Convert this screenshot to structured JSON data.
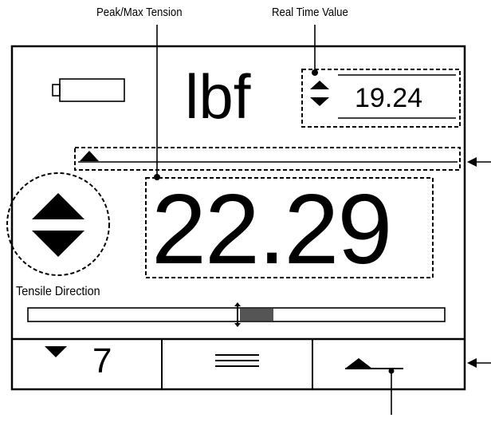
{
  "callouts": {
    "peak_max_tension": "Peak/Max Tension",
    "real_time_value": "Real Time Value"
  },
  "display": {
    "units": "lbf",
    "real_time_value": "19.24",
    "peak_value": "22.29",
    "direction_label": "Tensile Direction",
    "battery_icon": "battery-empty-icon",
    "direction_icon": "up-down-arrows-icon"
  },
  "buttons": {
    "left_value": "7",
    "left_icon": "triangle-down-icon",
    "middle_icon": "menu-lines-icon",
    "right_icon": "triangle-up-icon"
  }
}
